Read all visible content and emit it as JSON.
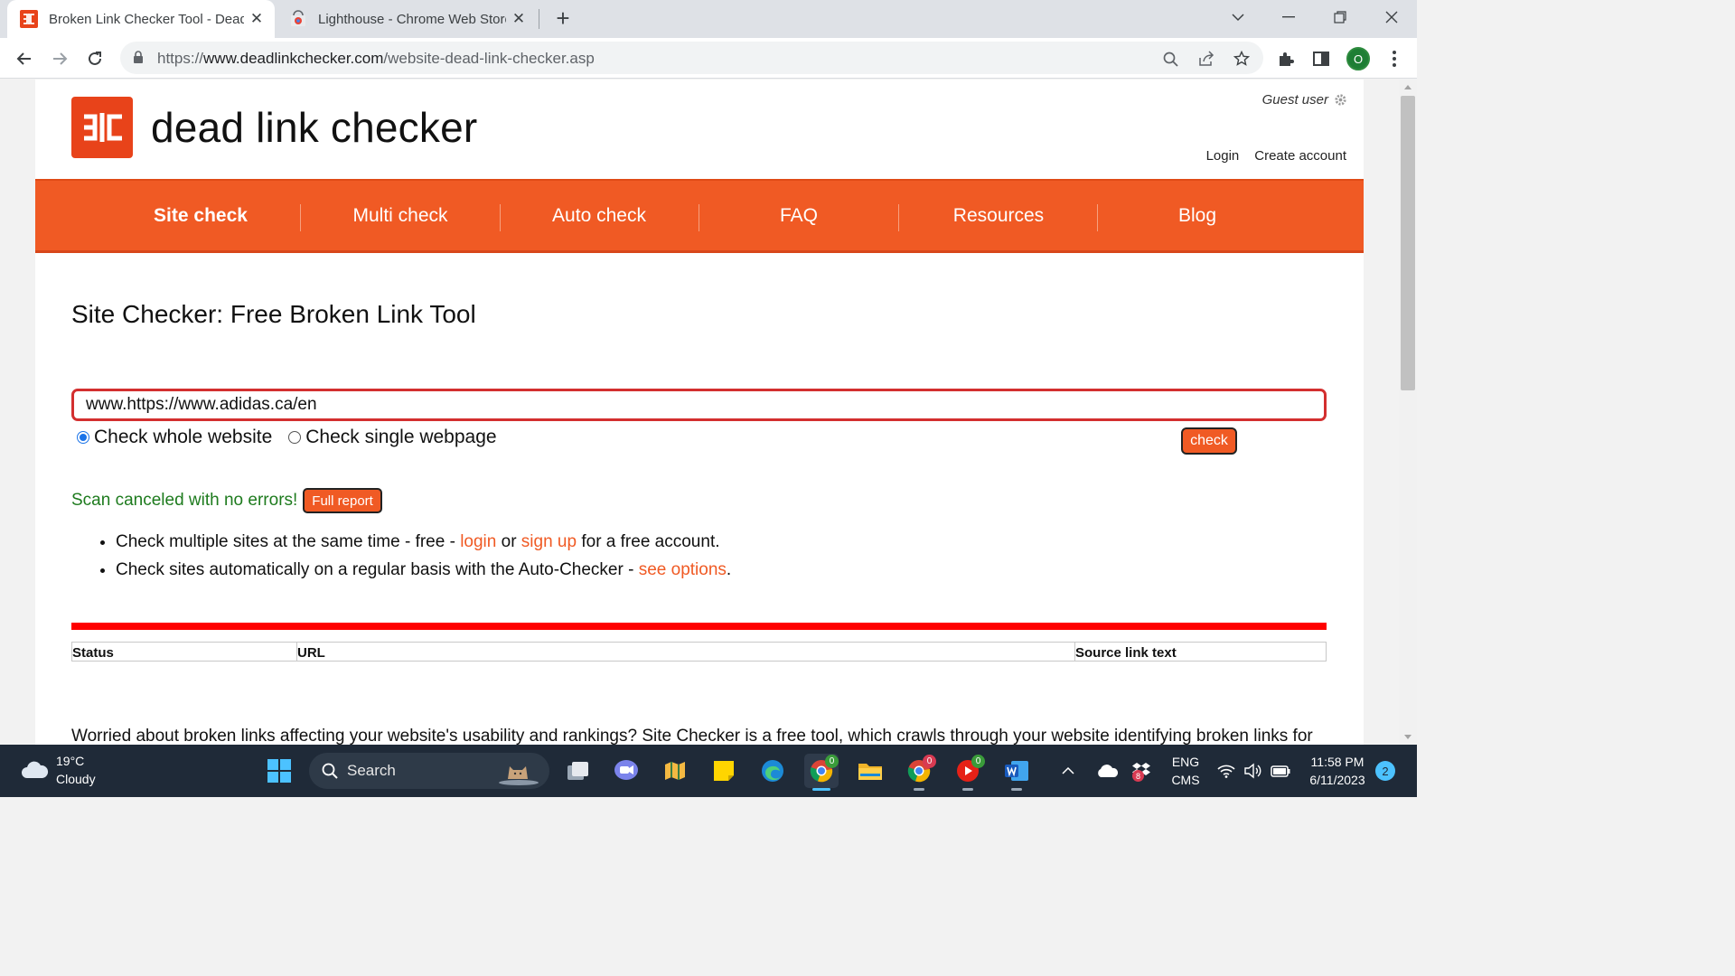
{
  "browser": {
    "tabs": [
      {
        "title": "Broken Link Checker Tool - Dead",
        "active": true
      },
      {
        "title": "Lighthouse - Chrome Web Store",
        "active": false
      }
    ],
    "url_prefix": "https://",
    "url_domain": "www.deadlinkchecker.com",
    "url_path": "/website-dead-link-checker.asp",
    "profile_initial": "O"
  },
  "site": {
    "logo_text": "dead link checker",
    "guest_label": "Guest user",
    "login": "Login",
    "create_account": "Create account",
    "nav": [
      "Site check",
      "Multi check",
      "Auto check",
      "FAQ",
      "Resources",
      "Blog"
    ],
    "active_nav": "Site check"
  },
  "main": {
    "heading": "Site Checker: Free Broken Link Tool",
    "url_value": "www.https://www.adidas.ca/en",
    "radio_whole": "Check whole website",
    "radio_single": "Check single webpage",
    "selected_radio": "Check whole website",
    "check_button": "check",
    "status_text": "Scan canceled with no errors!",
    "report_button": "Full report",
    "bullet1_pre": "Check multiple sites at the same time - free - ",
    "bullet1_link1": "login",
    "bullet1_mid": " or ",
    "bullet1_link2": "sign up",
    "bullet1_post": " for a free account.",
    "bullet2_pre": "Check sites automatically on a regular basis with the Auto-Checker - ",
    "bullet2_link": "see options",
    "bullet2_post": ".",
    "table_headers": [
      "Status",
      "URL",
      "Source link text"
    ],
    "bottom_text": "Worried about broken links affecting your website's usability and rankings? Site Checker is a free tool, which crawls through your website identifying broken links for"
  },
  "taskbar": {
    "temperature": "19°C",
    "condition": "Cloudy",
    "search_label": "Search",
    "lang_top": "ENG",
    "lang_bottom": "CMS",
    "time": "11:58 PM",
    "date": "6/11/2023",
    "notification_count": "2",
    "chrome_badge": "0",
    "chrome2_badge": "0",
    "yt_badge": "0",
    "tray_badge": "8"
  },
  "colors": {
    "brand_orange": "#f05a24",
    "status_green": "#1e7b1e",
    "link_orange": "#f05a24",
    "error_red": "#ff0000"
  }
}
